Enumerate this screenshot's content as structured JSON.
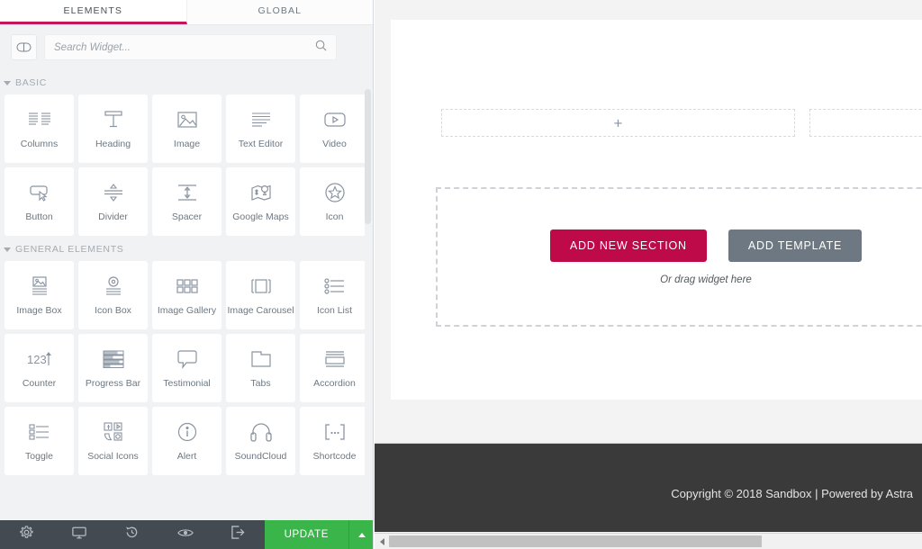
{
  "panel": {
    "tabs": [
      {
        "label": "ELEMENTS",
        "active": true
      },
      {
        "label": "GLOBAL",
        "active": false
      }
    ],
    "menu_icon": "menu-toggle-icon",
    "search": {
      "placeholder": "Search Widget...",
      "value": "",
      "icon": "search-icon"
    },
    "categories": [
      {
        "title": "BASIC",
        "widgets": [
          {
            "label": "Columns",
            "icon": "columns-icon"
          },
          {
            "label": "Heading",
            "icon": "heading-icon"
          },
          {
            "label": "Image",
            "icon": "image-icon"
          },
          {
            "label": "Text Editor",
            "icon": "text-editor-icon"
          },
          {
            "label": "Video",
            "icon": "video-icon"
          },
          {
            "label": "Button",
            "icon": "button-icon"
          },
          {
            "label": "Divider",
            "icon": "divider-icon"
          },
          {
            "label": "Spacer",
            "icon": "spacer-icon"
          },
          {
            "label": "Google Maps",
            "icon": "google-maps-icon"
          },
          {
            "label": "Icon",
            "icon": "star-icon"
          }
        ]
      },
      {
        "title": "GENERAL ELEMENTS",
        "widgets": [
          {
            "label": "Image Box",
            "icon": "image-box-icon"
          },
          {
            "label": "Icon Box",
            "icon": "icon-box-icon"
          },
          {
            "label": "Image Gallery",
            "icon": "image-gallery-icon"
          },
          {
            "label": "Image Carousel",
            "icon": "image-carousel-icon"
          },
          {
            "label": "Icon List",
            "icon": "icon-list-icon"
          },
          {
            "label": "Counter",
            "icon": "counter-icon"
          },
          {
            "label": "Progress Bar",
            "icon": "progress-bar-icon"
          },
          {
            "label": "Testimonial",
            "icon": "testimonial-icon"
          },
          {
            "label": "Tabs",
            "icon": "tabs-icon"
          },
          {
            "label": "Accordion",
            "icon": "accordion-icon"
          },
          {
            "label": "Toggle",
            "icon": "toggle-icon"
          },
          {
            "label": "Social Icons",
            "icon": "social-icons-icon"
          },
          {
            "label": "Alert",
            "icon": "alert-icon"
          },
          {
            "label": "SoundCloud",
            "icon": "soundcloud-icon"
          },
          {
            "label": "Shortcode",
            "icon": "shortcode-icon"
          }
        ]
      }
    ]
  },
  "toolbar": {
    "buttons": [
      {
        "icon": "gear-icon",
        "name": "settings"
      },
      {
        "icon": "monitor-icon",
        "name": "responsive-mode"
      },
      {
        "icon": "history-icon",
        "name": "revision-history"
      },
      {
        "icon": "eye-icon",
        "name": "preview-changes"
      },
      {
        "icon": "exit-icon",
        "name": "exit-to-dashboard"
      }
    ],
    "update_label": "UPDATE",
    "update_caret_icon": "caret-up-icon",
    "update_color": "#39b54a"
  },
  "canvas": {
    "dropzone_plus_icon": "plus-icon",
    "add_section": {
      "primary_label": "ADD NEW SECTION",
      "secondary_label": "ADD TEMPLATE",
      "hint": "Or drag widget here",
      "primary_color": "#bf0a4a",
      "secondary_color": "#6d7882"
    },
    "footer_text": "Copyright © 2018 Sandbox | Powered by Astra",
    "scrollbar_left_icon": "caret-left-icon"
  },
  "colors": {
    "accent": "#c2185b",
    "crimson": "#bf0a4a",
    "green": "#39b54a",
    "toolbar_bg": "#434a51",
    "footer_bg": "#3a3a3a"
  }
}
